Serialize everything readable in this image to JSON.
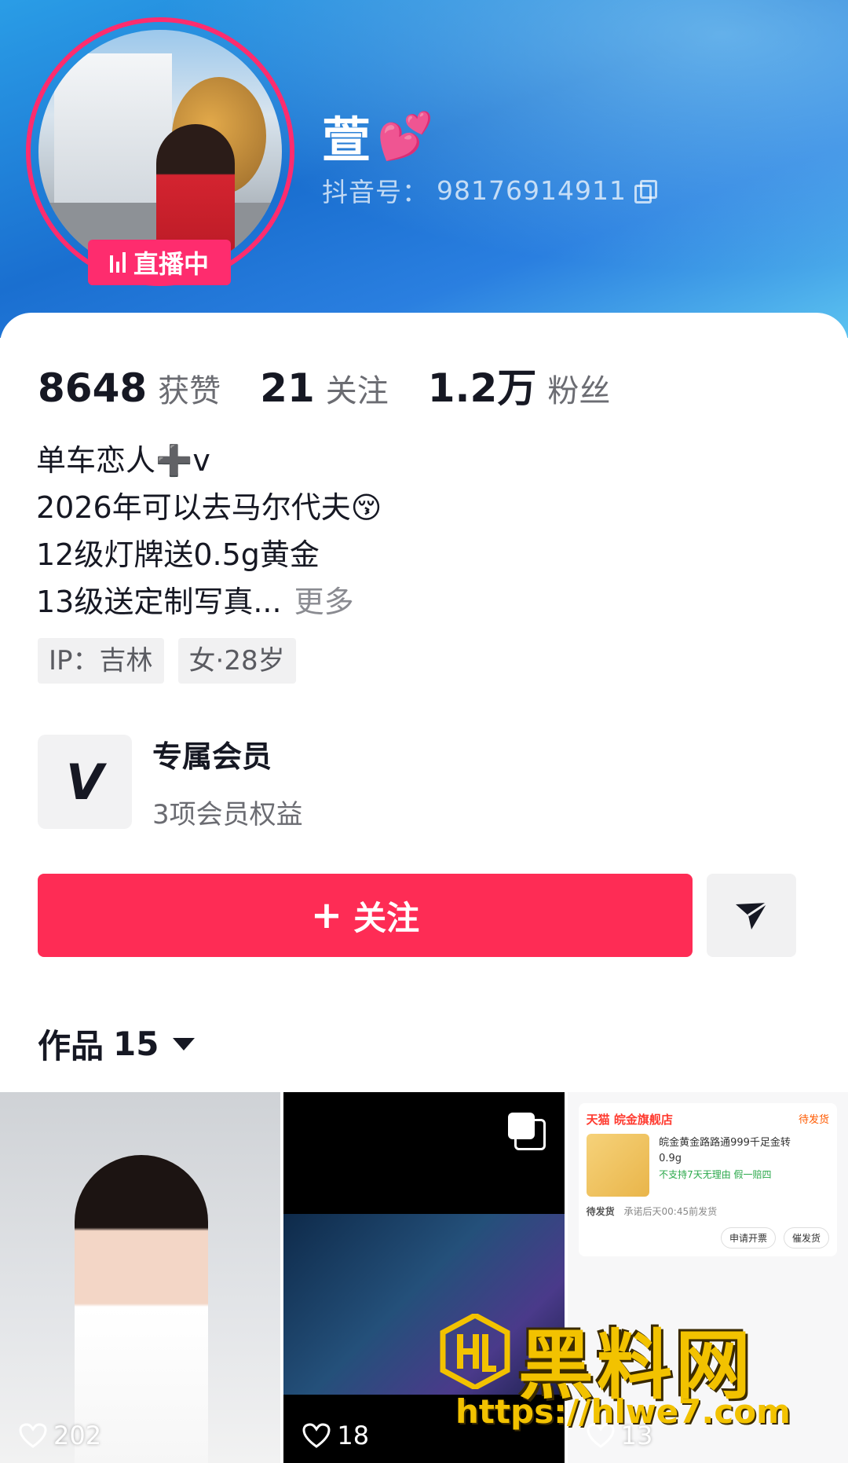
{
  "profile": {
    "name": "萱",
    "name_emoji": "💕",
    "id_label": "抖音号：",
    "id_value": "98176914911",
    "live_badge": "直播中"
  },
  "stats": [
    {
      "num": "8648",
      "label": "获赞"
    },
    {
      "num": "21",
      "label": "关注"
    },
    {
      "num": "1.2万",
      "label": "粉丝"
    }
  ],
  "bio": {
    "line1": "单车恋人➕v",
    "line2": "2026年可以去马尔代夫😚",
    "line3": "12级灯牌送0.5g黄金",
    "line4": "13级送定制写真...",
    "more": "更多"
  },
  "tags": [
    "IP：吉林",
    "女·28岁"
  ],
  "membership": {
    "icon_letter": "V",
    "title": "专属会员",
    "subtitle": "3项会员权益"
  },
  "actions": {
    "follow_plus": "+",
    "follow_label": "关注",
    "share_icon": "send-icon"
  },
  "works": {
    "label": "作品",
    "count": "15"
  },
  "grid": [
    {
      "likes": "202"
    },
    {
      "likes": "18"
    },
    {
      "likes": "13"
    }
  ],
  "order_card": {
    "shop": "天猫 皖金旗舰店",
    "status": "待发货",
    "product": "皖金黄金路路通999千足金转",
    "spec": "0.9g",
    "note": "不支持7天无理由  假一赔四",
    "pending": "待发货",
    "promise": "承诺后天00:45前发货",
    "btn1": "申请开票",
    "btn2": "催发货"
  },
  "watermark": {
    "text": "黑料网",
    "url": "https://hlwe7.com"
  },
  "colors": {
    "accent": "#fe2c55",
    "live": "#fe2c6e",
    "header": "#1a6fd0"
  }
}
